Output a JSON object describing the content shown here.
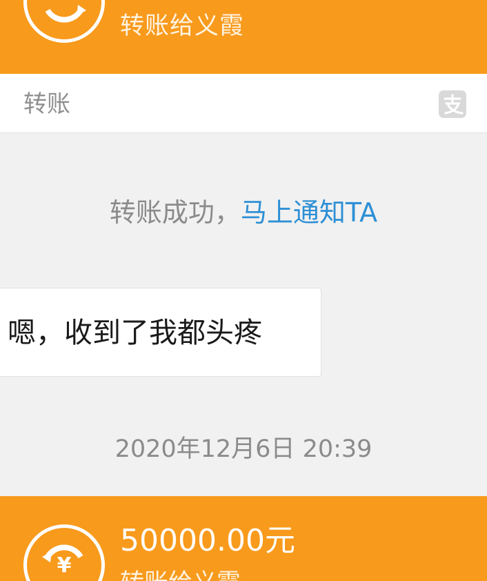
{
  "top_card": {
    "title": "转账给义霞",
    "icon": "yuan-exchange-icon"
  },
  "top_card_footer": {
    "label": "转账",
    "icon": "alipay-icon"
  },
  "notice": {
    "text": "转账成功，",
    "link": "马上通知TA"
  },
  "message": {
    "text": "嗯，收到了我都头疼"
  },
  "timestamp": "2020年12月6日 20:39",
  "bottom_card": {
    "amount": "50000.00元",
    "title": "转账给义霞",
    "icon": "yuan-exchange-icon"
  },
  "colors": {
    "card_orange": "#f89a1c",
    "link_blue": "#2d8fd5",
    "background": "#f1f1f1"
  }
}
